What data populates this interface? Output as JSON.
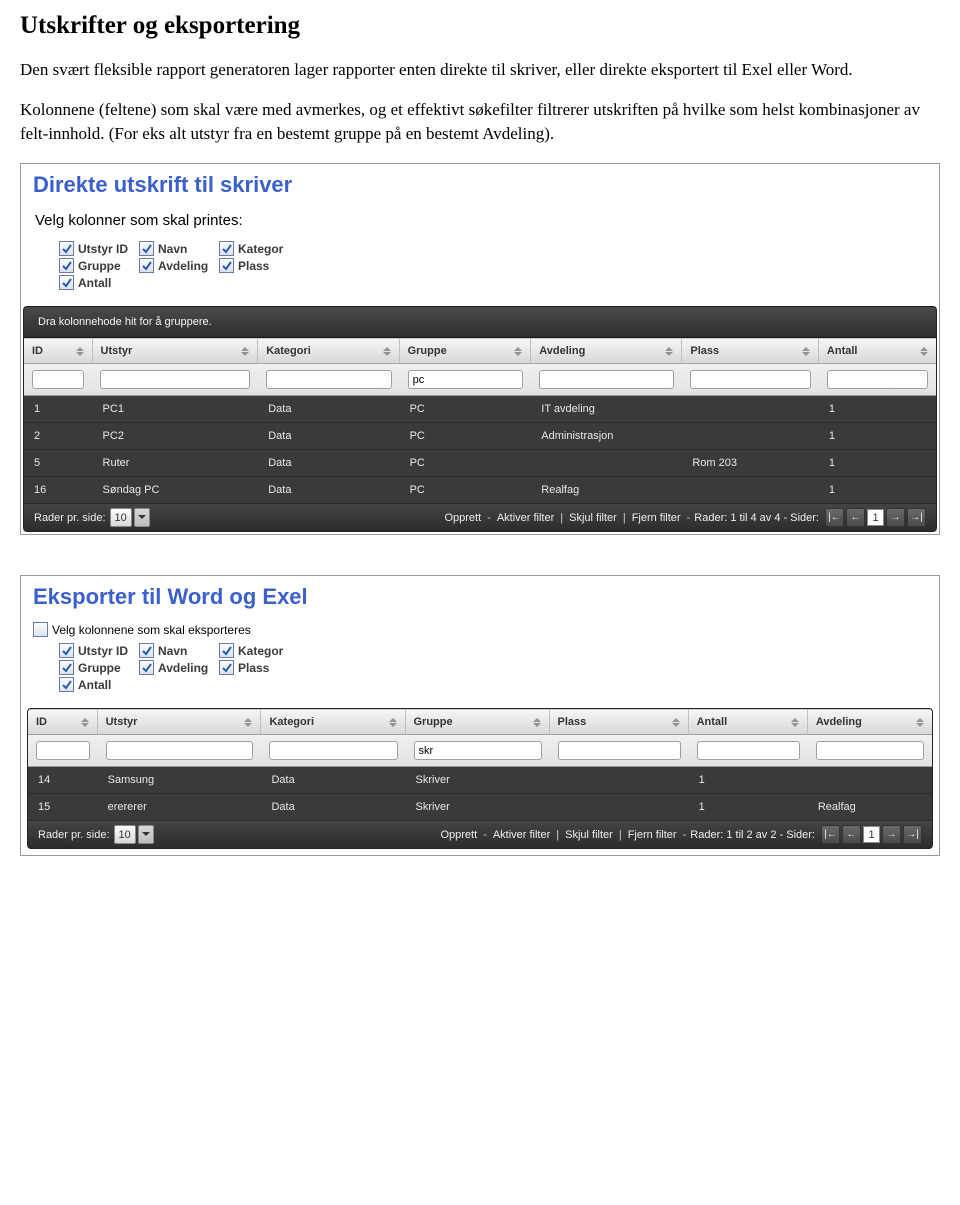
{
  "doc": {
    "heading": "Utskrifter og eksportering",
    "para1": "Den svært fleksible rapport generatoren lager rapporter enten direkte til skriver, eller direkte eksportert til Exel eller Word.",
    "para2": "Kolonnene (feltene) som skal være med avmerkes, og et effektivt søkefilter filtrerer utskriften på hvilke som helst kombinasjoner av felt-innhold. (For eks alt utstyr fra en bestemt gruppe på en bestemt Avdeling)."
  },
  "panel1": {
    "title": "Direkte utskrift til skriver",
    "sub": "Velg kolonner som skal printes:",
    "checkboxes": {
      "r1": [
        "Utstyr ID",
        "Navn",
        "Kategor"
      ],
      "r2": [
        "Gruppe",
        "Avdeling",
        "Plass"
      ],
      "r3": [
        "Antall"
      ]
    },
    "groupBar": "Dra kolonnehode hit for å gruppere.",
    "columns": [
      "ID",
      "Utstyr",
      "Kategori",
      "Gruppe",
      "Avdeling",
      "Plass",
      "Antall"
    ],
    "filters": [
      "",
      "",
      "",
      "pc",
      "",
      "",
      ""
    ],
    "rows": [
      [
        "1",
        "PC1",
        "Data",
        "PC",
        "IT avdeling",
        "",
        "1"
      ],
      [
        "2",
        "PC2",
        "Data",
        "PC",
        "Administrasjon",
        "",
        "1"
      ],
      [
        "5",
        "Ruter",
        "Data",
        "PC",
        "",
        "Rom 203",
        "1"
      ],
      [
        "16",
        "Søndag PC",
        "Data",
        "PC",
        "Realfag",
        "",
        "1"
      ]
    ],
    "footer": {
      "perside": "Rader pr. side:",
      "persideVal": "10",
      "opprett": "Opprett",
      "aktiver": "Aktiver filter",
      "skjul": "Skjul filter",
      "fjern": "Fjern filter",
      "rader": "Rader: 1 til 4 av 4 - Sider:",
      "cur": "1"
    }
  },
  "panel2": {
    "title": "Eksporter til Word og Exel",
    "outerCb": "Velg kolonnene som skal eksporteres",
    "checkboxes": {
      "r1": [
        "Utstyr ID",
        "Navn",
        "Kategor"
      ],
      "r2": [
        "Gruppe",
        "Avdeling",
        "Plass"
      ],
      "r3": [
        "Antall"
      ]
    },
    "columns": [
      "ID",
      "Utstyr",
      "Kategori",
      "Gruppe",
      "Plass",
      "Antall",
      "Avdeling"
    ],
    "filters": [
      "",
      "",
      "",
      "skr",
      "",
      "",
      ""
    ],
    "rows": [
      [
        "14",
        "Samsung",
        "Data",
        "Skriver",
        "",
        "1",
        ""
      ],
      [
        "15",
        "erererer",
        "Data",
        "Skriver",
        "",
        "1",
        "Realfag"
      ]
    ],
    "footer": {
      "perside": "Rader pr. side:",
      "persideVal": "10",
      "opprett": "Opprett",
      "aktiver": "Aktiver filter",
      "skjul": "Skjul filter",
      "fjern": "Fjern filter",
      "rader": "Rader: 1 til 2 av 2 - Sider:",
      "cur": "1"
    }
  }
}
